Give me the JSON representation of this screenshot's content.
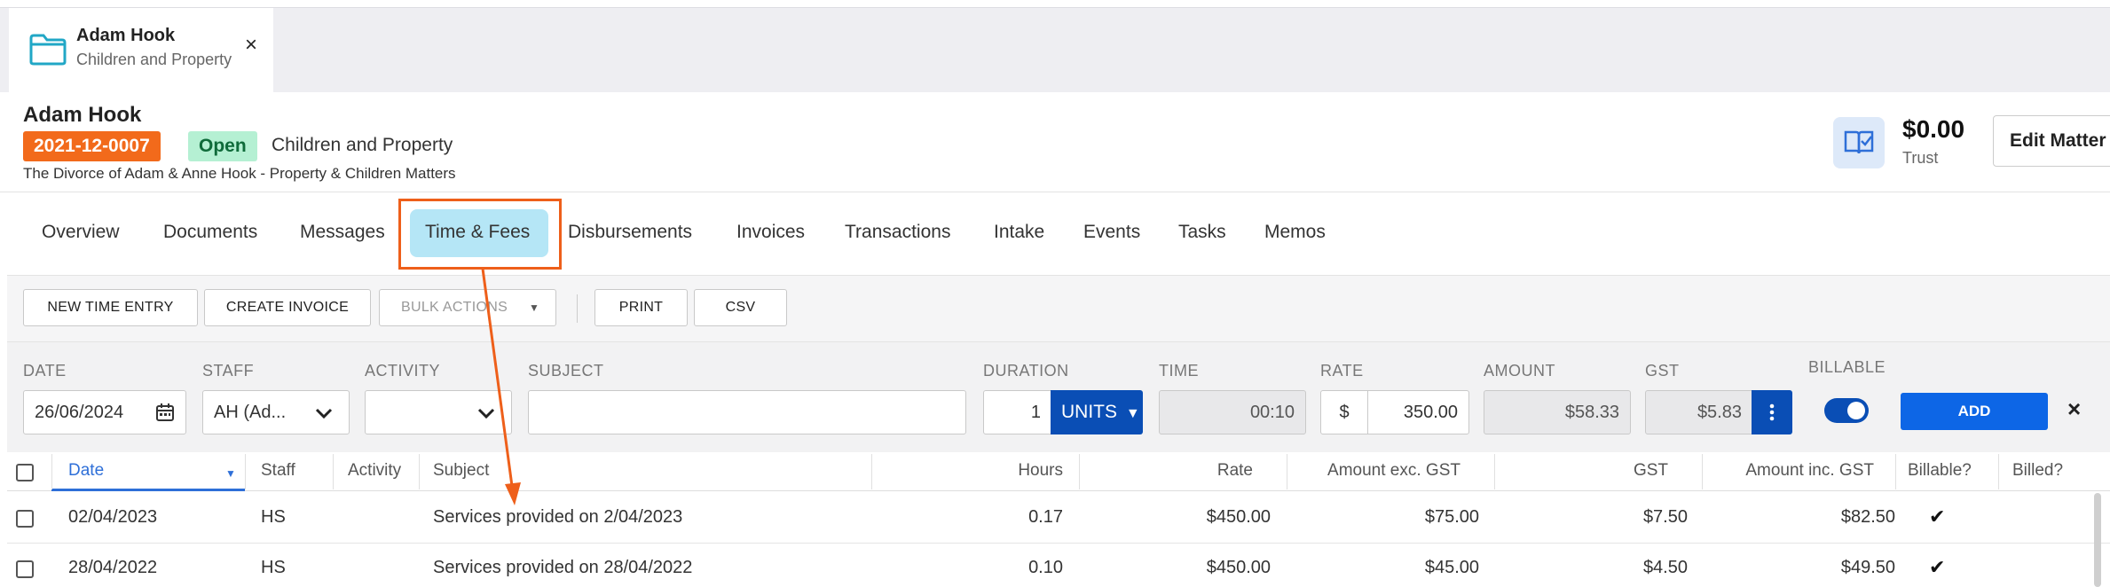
{
  "tab": {
    "title": "Adam Hook",
    "subtitle": "Children and Property",
    "close": "×"
  },
  "matter": {
    "name": "Adam Hook",
    "number": "2021-12-0007",
    "status": "Open",
    "type": "Children and Property",
    "description": "The Divorce of Adam & Anne Hook - Property & Children Matters"
  },
  "trust": {
    "amount": "$0.00",
    "label": "Trust"
  },
  "header": {
    "edit_label": "Edit Matter"
  },
  "nav": {
    "overview": "Overview",
    "documents": "Documents",
    "messages": "Messages",
    "time_fees": "Time & Fees",
    "disbursements": "Disbursements",
    "invoices": "Invoices",
    "transactions": "Transactions",
    "intake": "Intake",
    "events": "Events",
    "tasks": "Tasks",
    "memos": "Memos",
    "active": "Time & Fees"
  },
  "toolbar": {
    "new_time_entry": "NEW TIME ENTRY",
    "create_invoice": "CREATE INVOICE",
    "bulk_actions": "BULK ACTIONS",
    "print": "PRINT",
    "csv": "CSV"
  },
  "entry_form": {
    "labels": {
      "date": "DATE",
      "staff": "STAFF",
      "activity": "ACTIVITY",
      "subject": "SUBJECT",
      "duration": "DURATION",
      "time": "TIME",
      "rate": "RATE",
      "amount": "AMOUNT",
      "gst": "GST",
      "billable": "BILLABLE"
    },
    "date": "26/06/2024",
    "staff": "AH (Ad...",
    "activity": "",
    "subject": "",
    "duration": "1",
    "units": "UNITS",
    "time": "00:10",
    "rate_currency": "$",
    "rate": "350.00",
    "amount": "$58.33",
    "gst": "$5.83",
    "billable": true,
    "add_label": "ADD",
    "clear": "×"
  },
  "table": {
    "columns": {
      "date": "Date",
      "staff": "Staff",
      "activity": "Activity",
      "subject": "Subject",
      "hours": "Hours",
      "rate": "Rate",
      "amount_ex": "Amount exc. GST",
      "gst": "GST",
      "amount_inc": "Amount inc. GST",
      "billable": "Billable?",
      "billed": "Billed?"
    },
    "rows": [
      {
        "date": "02/04/2023",
        "staff": "HS",
        "activity": "",
        "subject": "Services provided on 2/04/2023",
        "hours": "0.17",
        "rate": "$450.00",
        "amount_ex": "$75.00",
        "gst": "$7.50",
        "amount_inc": "$82.50",
        "billable": "✔",
        "billed": ""
      },
      {
        "date": "28/04/2022",
        "staff": "HS",
        "activity": "",
        "subject": "Services provided on 28/04/2022",
        "hours": "0.10",
        "rate": "$450.00",
        "amount_ex": "$45.00",
        "gst": "$4.50",
        "amount_inc": "$49.50",
        "billable": "✔",
        "billed": ""
      }
    ]
  },
  "icons": {
    "tab": "folder-icon",
    "trust": "book-check-icon",
    "date_picker": "calendar-icon",
    "dropdown": "chevron-down-icon",
    "gst_menu": "kebab-icon",
    "sort": "sort-desc-icon"
  },
  "colors": {
    "matter_number": "#f26a1b",
    "status_open": "#b5f0d3",
    "nav_active": "#b5e6f6",
    "primary": "#0a4eb5",
    "add_button": "#0d66e6",
    "annotation": "#ee5f1a"
  }
}
